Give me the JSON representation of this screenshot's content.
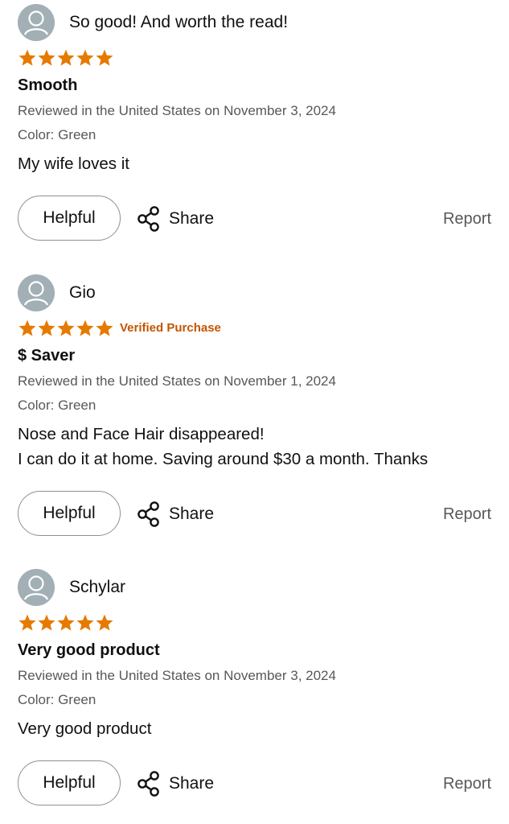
{
  "colors": {
    "star": "#e67a00",
    "verified": "#c45500",
    "meta": "#565959",
    "avatar": "#a2b0b6"
  },
  "icons": {
    "avatar": "user-avatar-icon",
    "star": "star-icon",
    "share": "share-icon"
  },
  "reviews": [
    {
      "reviewer": "So good! And worth the read!",
      "rating": 5,
      "verified": "",
      "title": "Smooth",
      "date": "Reviewed in the United States on November 3, 2024",
      "color": "Color: Green",
      "body": [
        "My wife loves it"
      ],
      "helpful_label": "Helpful",
      "share_label": "Share",
      "report_label": "Report"
    },
    {
      "reviewer": "Gio",
      "rating": 5,
      "verified": "Verified Purchase",
      "title": "$ Saver",
      "date": "Reviewed in the United States on November 1, 2024",
      "color": "Color: Green",
      "body": [
        "Nose and Face Hair disappeared!",
        "I can do it at home. Saving around $30 a month. Thanks"
      ],
      "helpful_label": "Helpful",
      "share_label": "Share",
      "report_label": "Report"
    },
    {
      "reviewer": "Schylar",
      "rating": 5,
      "verified": "",
      "title": "Very good product",
      "date": "Reviewed in the United States on November 3, 2024",
      "color": "Color: Green",
      "body": [
        "Very good product"
      ],
      "helpful_label": "Helpful",
      "share_label": "Share",
      "report_label": "Report"
    }
  ]
}
